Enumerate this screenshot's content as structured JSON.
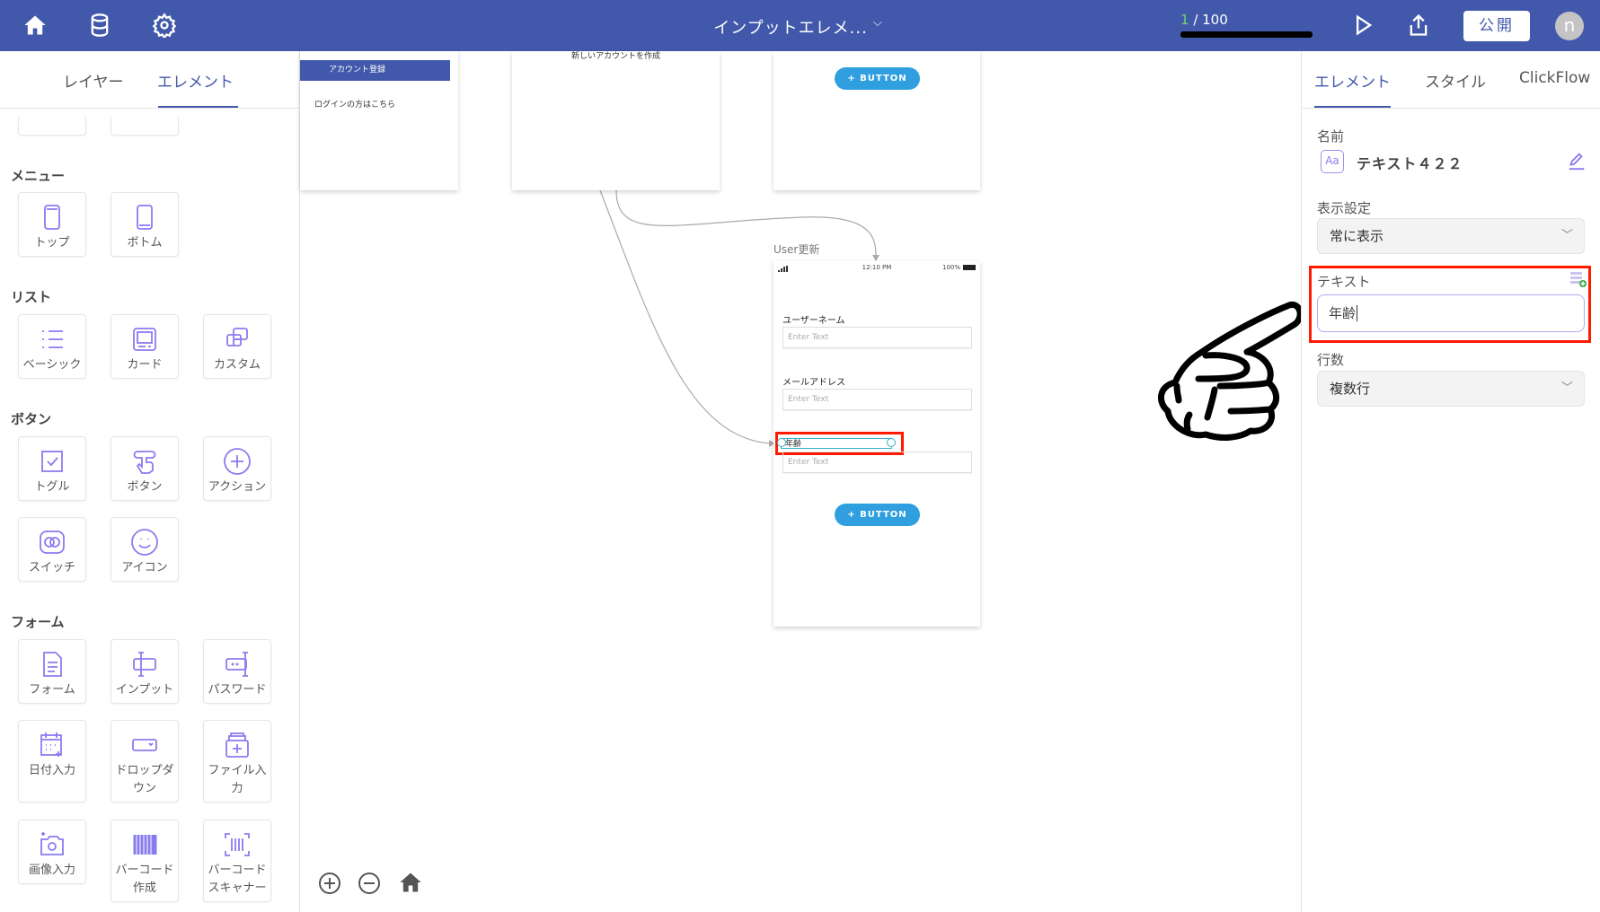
{
  "topbar": {
    "title": "インプットエレメ...",
    "progress_current": "1",
    "progress_total": " / 100",
    "publish": "公開",
    "avatar": "n",
    "icons": [
      "home-icon",
      "database-icon",
      "gear-icon",
      "play-icon",
      "share-icon"
    ]
  },
  "left": {
    "tabs": [
      "レイヤー",
      "エレメント"
    ],
    "active_tab": 1,
    "sections": [
      {
        "title": "メニュー",
        "items": [
          {
            "label": "トップ",
            "icon": "top-menu"
          },
          {
            "label": "ボトム",
            "icon": "bottom-menu"
          }
        ]
      },
      {
        "title": "リスト",
        "items": [
          {
            "label": "ベーシック",
            "icon": "list"
          },
          {
            "label": "カード",
            "icon": "card"
          },
          {
            "label": "カスタム",
            "icon": "custom"
          }
        ]
      },
      {
        "title": "ボタン",
        "items": [
          {
            "label": "トグル",
            "icon": "checkbox"
          },
          {
            "label": "ボタン",
            "icon": "tap"
          },
          {
            "label": "アクション",
            "icon": "plus-circle"
          },
          {
            "label": "スイッチ",
            "icon": "switch"
          },
          {
            "label": "アイコン",
            "icon": "smiley"
          }
        ]
      },
      {
        "title": "フォーム",
        "items": [
          {
            "label": "フォーム",
            "icon": "document"
          },
          {
            "label": "インプット",
            "icon": "input"
          },
          {
            "label": "パスワード",
            "icon": "password"
          },
          {
            "label": "日付入力",
            "icon": "calendar"
          },
          {
            "label": "ドロップダウン",
            "icon": "dropdown"
          },
          {
            "label": "ファイル入力",
            "icon": "file"
          },
          {
            "label": "画像入力",
            "icon": "camera"
          },
          {
            "label": "バーコード作成",
            "icon": "barcode"
          },
          {
            "label": "バーコードスキャナー",
            "icon": "scanner"
          }
        ]
      }
    ]
  },
  "canvas": {
    "card1": {
      "header": "アカウント登録",
      "link": "ログインの方はこちら"
    },
    "card2": {
      "text": "新しいアカウントを作成"
    },
    "card3": {
      "button": "+ BUTTON"
    },
    "screen": {
      "title": "User更新",
      "time": "12:10 PM",
      "battery": "100%",
      "fields": [
        {
          "label": "ユーザーネーム",
          "placeholder": "Enter Text"
        },
        {
          "label": "メールアドレス",
          "placeholder": "Enter Text"
        },
        {
          "label": "年齢",
          "placeholder": "Enter Text"
        }
      ],
      "button": "+ BUTTON"
    }
  },
  "right": {
    "tabs": [
      "エレメント",
      "スタイル",
      "ClickFlow"
    ],
    "name_label": "名前",
    "name_icon": "Aa",
    "name_value": "テキスト４２２",
    "visibility_label": "表示設定",
    "visibility_value": "常に表示",
    "text_label": "テキスト",
    "text_value": "年齢",
    "lines_label": "行数",
    "lines_value": "複数行"
  },
  "colors": {
    "primary": "#4259ab",
    "accent_button": "#2f9fdf",
    "highlight": "#ff1a00",
    "icon": "#8a7cf0"
  }
}
